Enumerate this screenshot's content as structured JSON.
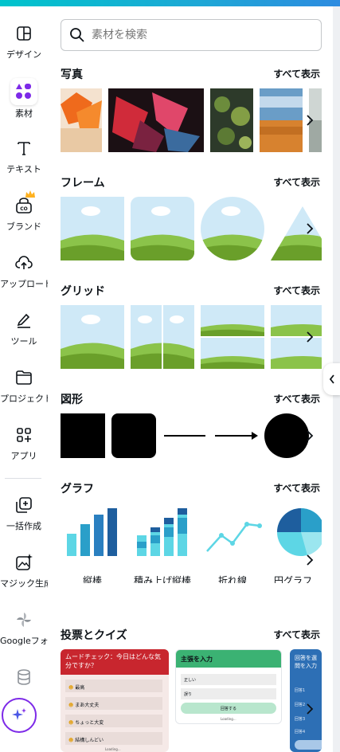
{
  "rail": {
    "items": [
      {
        "label": "デザイン",
        "icon": "layout-icon"
      },
      {
        "label": "素材",
        "icon": "elements-icon"
      },
      {
        "label": "テキスト",
        "icon": "text-icon"
      },
      {
        "label": "ブランド",
        "icon": "brand-icon"
      },
      {
        "label": "アップロード",
        "icon": "upload-icon"
      },
      {
        "label": "ツール",
        "icon": "draw-icon"
      },
      {
        "label": "プロジェクト",
        "icon": "folder-icon"
      },
      {
        "label": "アプリ",
        "icon": "apps-icon"
      },
      {
        "label": "一括作成",
        "icon": "bulk-create-icon"
      },
      {
        "label": "マジック生成",
        "icon": "magic-media-icon"
      },
      {
        "label": "Googleフォト",
        "icon": "google-photos-icon"
      },
      {
        "label": "",
        "icon": "database-icon"
      }
    ]
  },
  "search": {
    "placeholder": "素材を検索"
  },
  "sections": {
    "photos": {
      "title": "写真",
      "see_all": "すべて表示"
    },
    "frames": {
      "title": "フレーム",
      "see_all": "すべて表示"
    },
    "grids": {
      "title": "グリッド",
      "see_all": "すべて表示"
    },
    "shapes": {
      "title": "図形",
      "see_all": "すべて表示"
    },
    "charts": {
      "title": "グラフ",
      "see_all": "すべて表示",
      "items": [
        "縦棒",
        "積み上げ縦棒",
        "折れ線",
        "円グラフ"
      ]
    },
    "quiz": {
      "title": "投票とクイズ",
      "see_all": "すべて表示"
    }
  },
  "quiz_cards": {
    "mood": {
      "question": "ムードチェック：今日はどんな気分ですか？",
      "options": [
        "最高",
        "まあ大丈夫",
        "ちょっと大変",
        "結構しんどい"
      ],
      "loading": "Loading..."
    },
    "opinion": {
      "header": "主張を入力",
      "options": [
        "正しい",
        "誤り"
      ],
      "button": "回答する",
      "loading": "Loading..."
    },
    "third": {
      "header": "回答を選",
      "sub": "問を入力",
      "lines": [
        "回答1",
        "回答2",
        "回答3",
        "回答4"
      ]
    }
  },
  "colors": {
    "accent": "#7d2ae8",
    "teal": "#00c4cc",
    "chart_light": "#5dd6e5",
    "chart_mid": "#2a9fc9",
    "chart_dark": "#1e5e9e"
  }
}
